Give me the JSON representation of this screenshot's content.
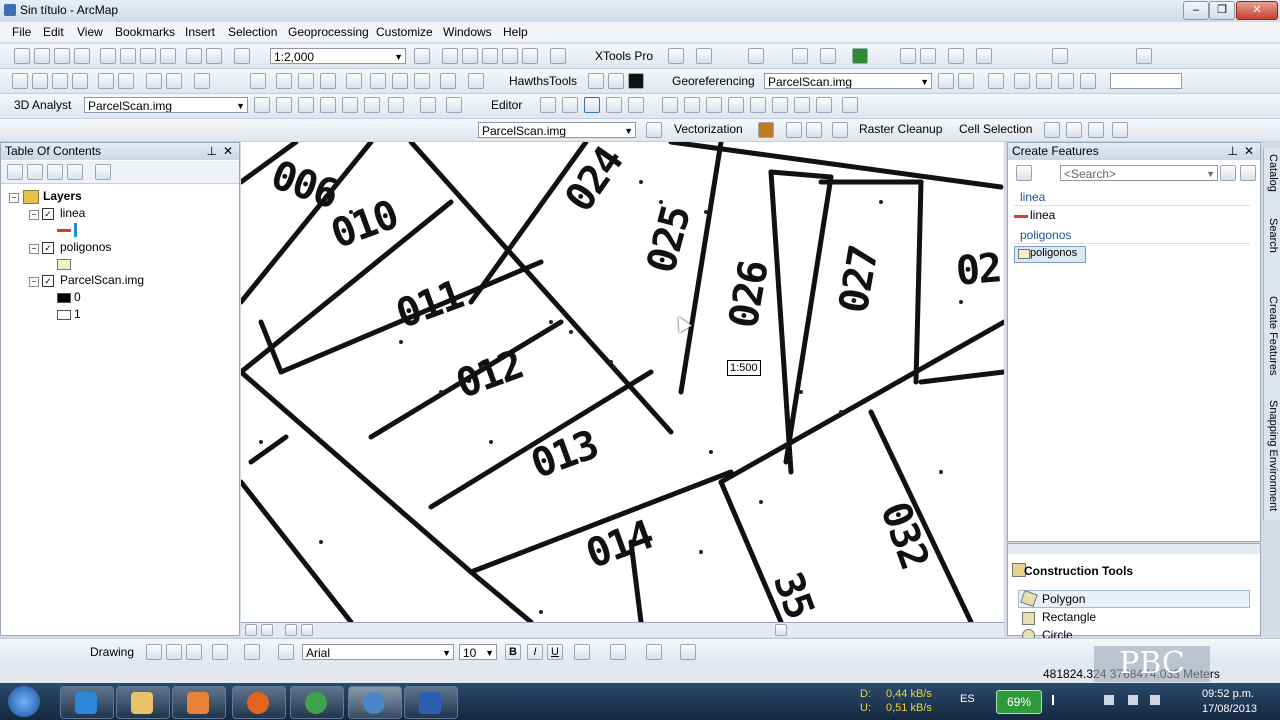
{
  "window": {
    "title": "Sin título - ArcMap"
  },
  "menu": [
    "File",
    "Edit",
    "View",
    "Bookmarks",
    "Insert",
    "Selection",
    "Geoprocessing",
    "Customize",
    "Windows",
    "Help"
  ],
  "toolbar1": {
    "scale": "1:2,000",
    "xtools": "XTools Pro"
  },
  "toolbar2": {
    "hawths": "HawthsTools",
    "georef": "Georeferencing",
    "georef_layer": "ParcelScan.img"
  },
  "toolbar3": {
    "analyst": "3D Analyst",
    "analyst_layer": "ParcelScan.img",
    "editor": "Editor"
  },
  "toolbar4": {
    "raster_layer": "ParcelScan.img",
    "vectorization": "Vectorization",
    "raster_cleanup": "Raster Cleanup",
    "cell_selection": "Cell Selection"
  },
  "toc": {
    "title": "Table Of Contents",
    "root": "Layers",
    "layers": [
      {
        "name": "linea",
        "checked": true
      },
      {
        "name": "poligonos",
        "checked": true
      },
      {
        "name": "ParcelScan.img",
        "checked": true
      }
    ],
    "raster_values": [
      "0",
      "1"
    ]
  },
  "map": {
    "scale_tip": "1:500",
    "parcels": [
      "006",
      "010",
      "024",
      "025",
      "026",
      "027",
      "02",
      "011",
      "012",
      "013",
      "014",
      "032",
      "35"
    ]
  },
  "create_features": {
    "title": "Create Features",
    "search_placeholder": "<Search>",
    "groups": [
      {
        "name": "linea",
        "item": "linea"
      },
      {
        "name": "poligonos",
        "item": "poligonos"
      }
    ]
  },
  "construction_tools": {
    "title": "Construction Tools",
    "items": [
      "Polygon",
      "Rectangle",
      "Circle"
    ]
  },
  "side_tabs": [
    "Catalog",
    "Search",
    "Create Features",
    "Snapping Environment"
  ],
  "drawing_toolbar": {
    "drawing": "Drawing",
    "font": "Arial",
    "size": "10"
  },
  "status": {
    "coords": "481824.324  3768474.033 Meters"
  },
  "watermark": "PBC",
  "taskbar": {
    "lang": "ES",
    "battery": "69%",
    "net_down_label": "D:",
    "net_down": "0,44 kB/s",
    "net_up_label": "U:",
    "net_up": "0,51 kB/s",
    "time": "09:52 p.m.",
    "date": "17/08/2013"
  }
}
